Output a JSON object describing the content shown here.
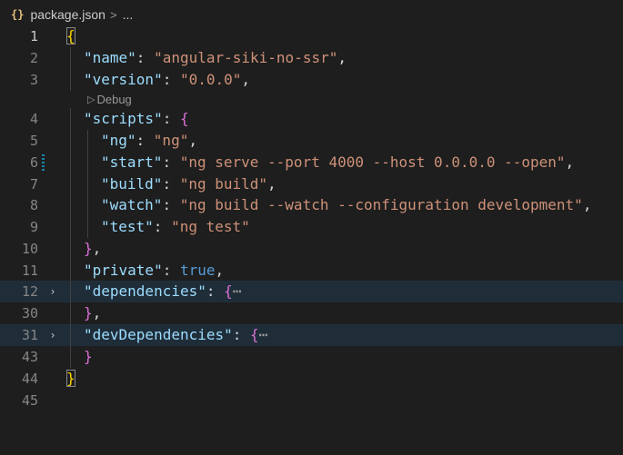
{
  "breadcrumb": {
    "icon": "{}",
    "file": "package.json",
    "separator": ">",
    "more": "..."
  },
  "codelens": {
    "icon": "▷",
    "label": "Debug"
  },
  "lines": {
    "l1": {
      "num": "1",
      "open": "{"
    },
    "l2": {
      "num": "2",
      "key": "\"name\"",
      "colon": ": ",
      "value": "\"angular-siki-no-ssr\"",
      "comma": ","
    },
    "l3": {
      "num": "3",
      "key": "\"version\"",
      "colon": ": ",
      "value": "\"0.0.0\"",
      "comma": ","
    },
    "l4": {
      "num": "4",
      "key": "\"scripts\"",
      "colon": ": ",
      "open": "{"
    },
    "l5": {
      "num": "5",
      "key": "\"ng\"",
      "colon": ": ",
      "value": "\"ng\"",
      "comma": ","
    },
    "l6": {
      "num": "6",
      "key": "\"start\"",
      "colon": ": ",
      "value": "\"ng serve --port 4000 --host 0.0.0.0 --open\"",
      "comma": ","
    },
    "l7": {
      "num": "7",
      "key": "\"build\"",
      "colon": ": ",
      "value": "\"ng build\"",
      "comma": ","
    },
    "l8": {
      "num": "8",
      "key": "\"watch\"",
      "colon": ": ",
      "value": "\"ng build --watch --configuration development\"",
      "comma": ","
    },
    "l9": {
      "num": "9",
      "key": "\"test\"",
      "colon": ": ",
      "value": "\"ng test\""
    },
    "l10": {
      "num": "10",
      "close": "}",
      "comma": ","
    },
    "l11": {
      "num": "11",
      "key": "\"private\"",
      "colon": ": ",
      "value": "true",
      "comma": ","
    },
    "l12": {
      "num": "12",
      "key": "\"dependencies\"",
      "colon": ": ",
      "open": "{",
      "ellipsis": "⋯"
    },
    "l30": {
      "num": "30",
      "close": "}",
      "comma": ","
    },
    "l31": {
      "num": "31",
      "key": "\"devDependencies\"",
      "colon": ": ",
      "open": "{",
      "ellipsis": "⋯"
    },
    "l43": {
      "num": "43",
      "close": "}"
    },
    "l44": {
      "num": "44",
      "close": "}"
    },
    "l45": {
      "num": "45"
    }
  },
  "fold_icon": "›"
}
